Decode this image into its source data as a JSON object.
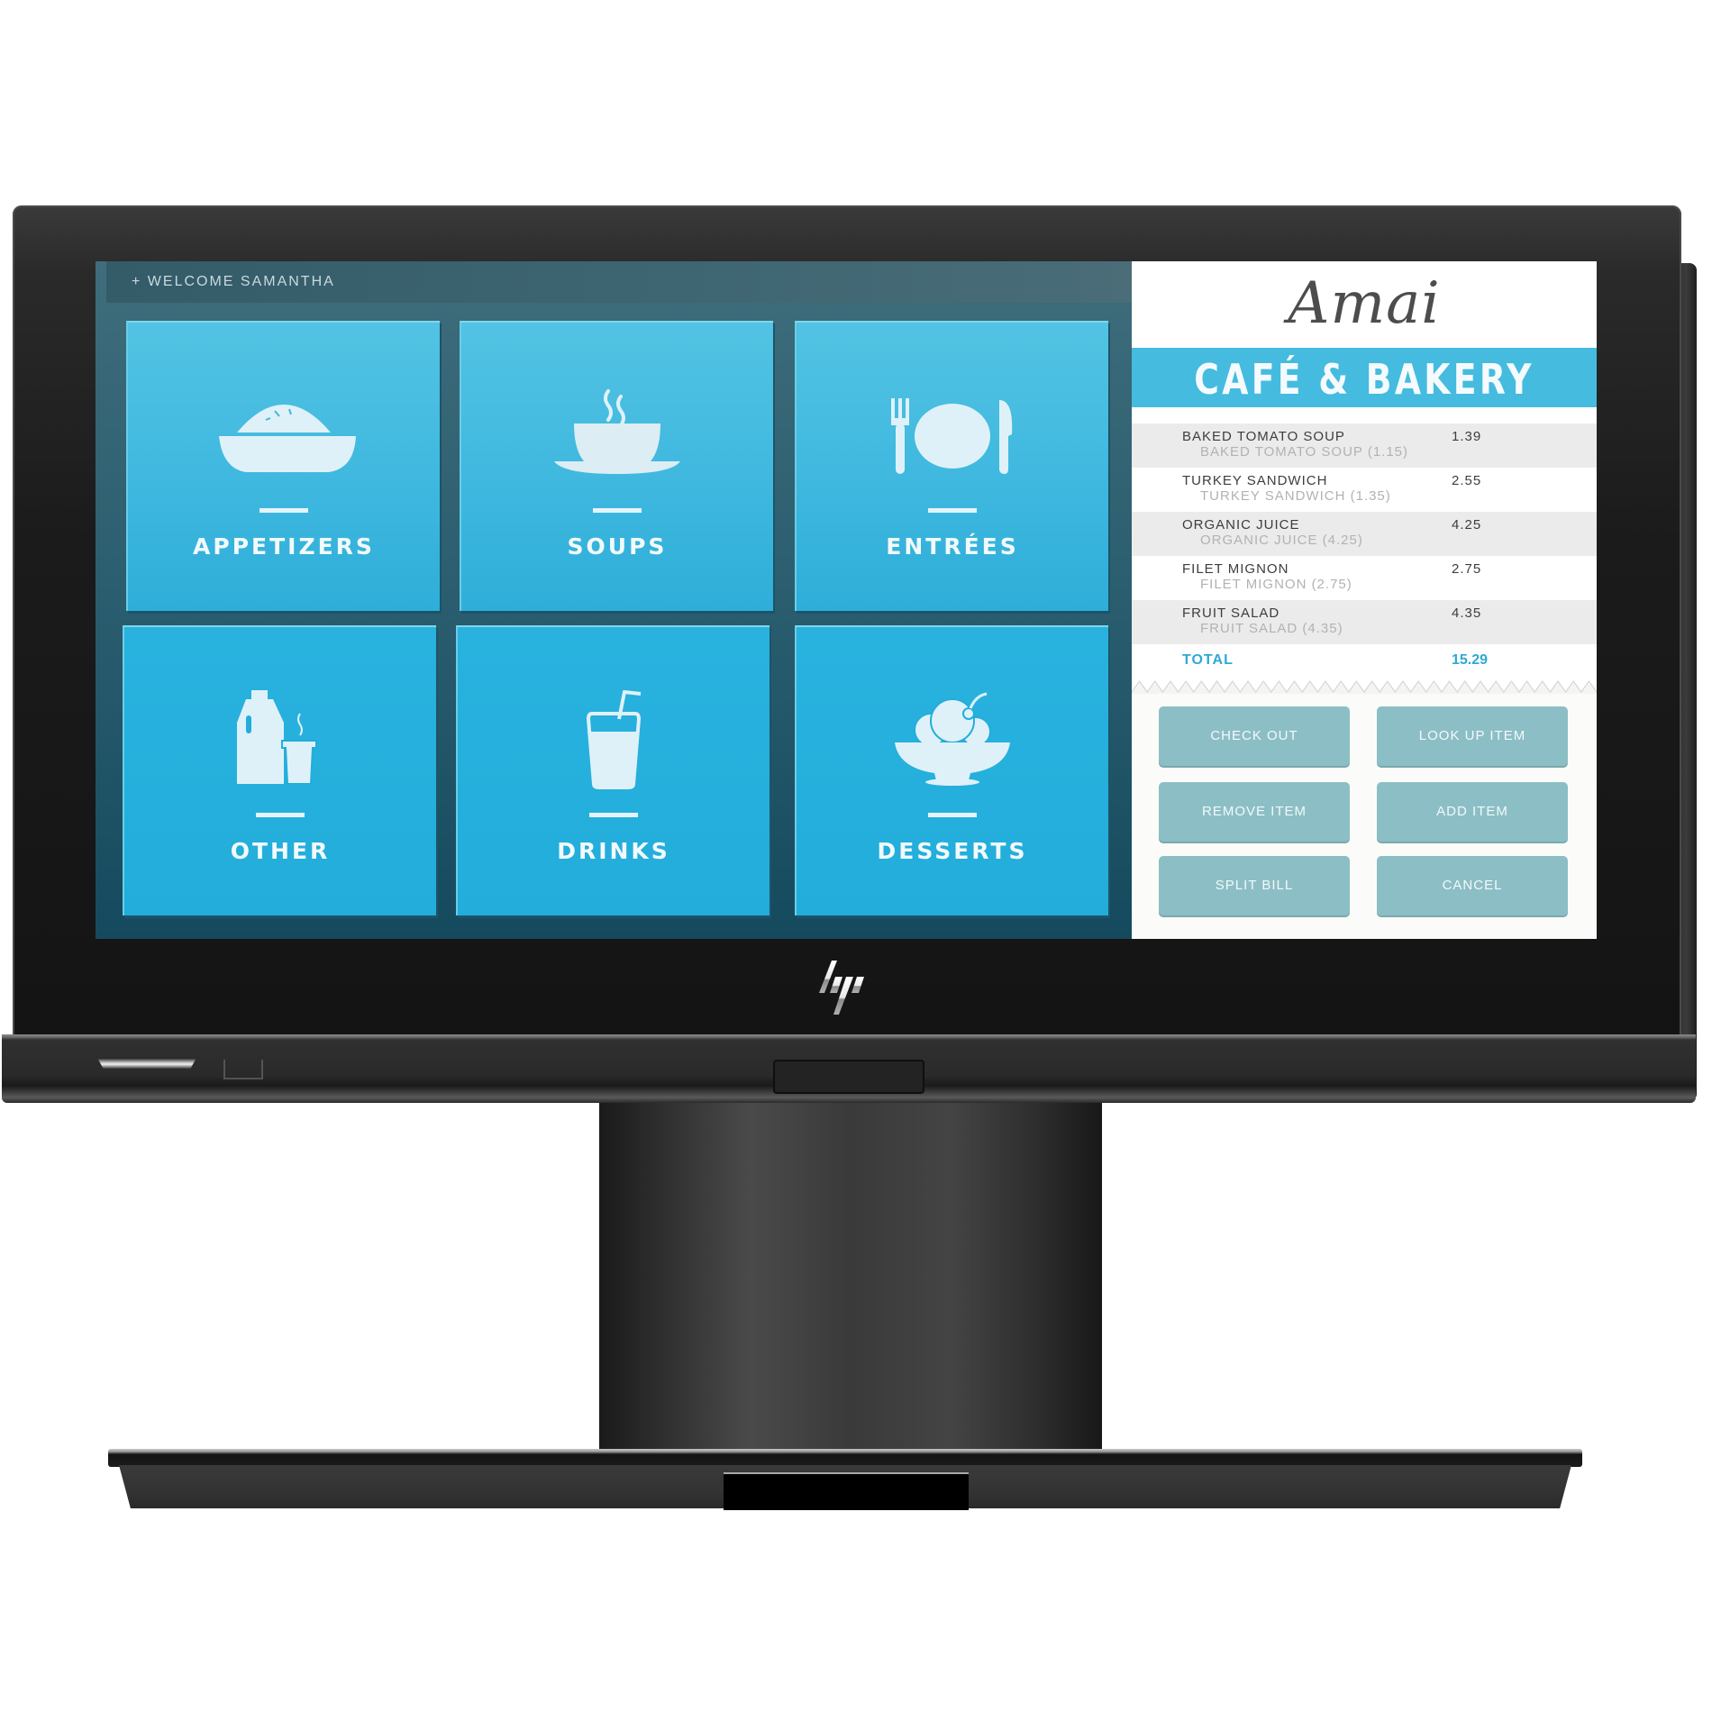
{
  "device": {
    "brand_logo": "hp-logo"
  },
  "header": {
    "welcome_text": "+ WELCOME SAMANTHA"
  },
  "categories": [
    {
      "label": "APPETIZERS",
      "icon": "pie-dish-icon"
    },
    {
      "label": "SOUPS",
      "icon": "soup-cup-icon"
    },
    {
      "label": "ENTRÉES",
      "icon": "plate-fork-knife-icon"
    },
    {
      "label": "OTHER",
      "icon": "milk-jug-coffee-icon"
    },
    {
      "label": "DRINKS",
      "icon": "glass-straw-icon"
    },
    {
      "label": "DESSERTS",
      "icon": "ice-cream-bowl-icon"
    }
  ],
  "receipt": {
    "brand_name": "Amai",
    "brand_subtitle": "CAFÉ & BAKERY",
    "items": [
      {
        "name": "BAKED TOMATO SOUP",
        "detail": "BAKED TOMATO SOUP (1.15)",
        "price": "1.39"
      },
      {
        "name": "TURKEY SANDWICH",
        "detail": "TURKEY SANDWICH (1.35)",
        "price": "2.55"
      },
      {
        "name": "ORGANIC JUICE",
        "detail": "ORGANIC JUICE (4.25)",
        "price": "4.25"
      },
      {
        "name": "FILET MIGNON",
        "detail": "FILET MIGNON (2.75)",
        "price": "2.75"
      },
      {
        "name": "FRUIT SALAD",
        "detail": "FRUIT SALAD (4.35)",
        "price": "4.35"
      }
    ],
    "total_label": "TOTAL",
    "total_value": "15.29"
  },
  "actions": {
    "check_out": "CHECK OUT",
    "look_up_item": "LOOK UP ITEM",
    "remove_item": "REMOVE ITEM",
    "add_item": "ADD ITEM",
    "split_bill": "SPLIT BILL",
    "cancel": "CANCEL"
  },
  "colors": {
    "tile_blue": "#3fb8df",
    "band_blue": "#45bbe0",
    "total_blue": "#2ea9d4",
    "action_teal": "#8cbfc5"
  }
}
